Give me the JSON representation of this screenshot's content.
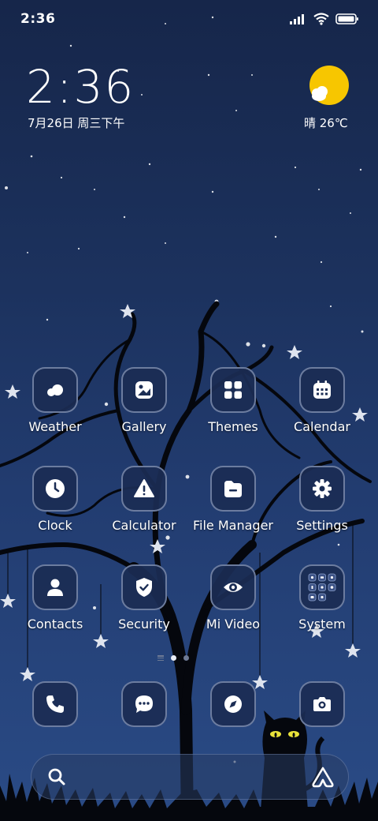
{
  "status_bar": {
    "time": "2:36",
    "icons": [
      "signal-icon",
      "wifi-icon",
      "battery-icon"
    ]
  },
  "clock_widget": {
    "time": "2:36",
    "date": "7月26日 周三下午"
  },
  "weather_widget": {
    "icon": "partly-sunny-icon",
    "text": "晴 26℃"
  },
  "apps": [
    {
      "label": "Weather",
      "icon": "weather-icon"
    },
    {
      "label": "Gallery",
      "icon": "gallery-icon"
    },
    {
      "label": "Themes",
      "icon": "themes-icon"
    },
    {
      "label": "Calendar",
      "icon": "calendar-icon"
    },
    {
      "label": "Clock",
      "icon": "clock-icon"
    },
    {
      "label": "Calculator",
      "icon": "calculator-icon"
    },
    {
      "label": "File Manager",
      "icon": "file-manager-icon"
    },
    {
      "label": "Settings",
      "icon": "settings-icon"
    },
    {
      "label": "Contacts",
      "icon": "contacts-icon"
    },
    {
      "label": "Security",
      "icon": "security-icon"
    },
    {
      "label": "Mi Video",
      "icon": "mi-video-icon"
    },
    {
      "label": "System",
      "icon": "system-folder-icon"
    }
  ],
  "dock": [
    {
      "icon": "phone-icon"
    },
    {
      "icon": "messages-icon"
    },
    {
      "icon": "browser-icon"
    },
    {
      "icon": "camera-icon"
    }
  ],
  "page_indicator": {
    "pages": 2,
    "current": 1
  },
  "search_bar": {
    "left_icon": "search-icon",
    "right_icon": "assistant-icon"
  },
  "colors": {
    "background_top": "#16264a",
    "background_bottom": "#2a4b86",
    "icon_tile": "#1b2d54",
    "sun": "#f7c600"
  }
}
